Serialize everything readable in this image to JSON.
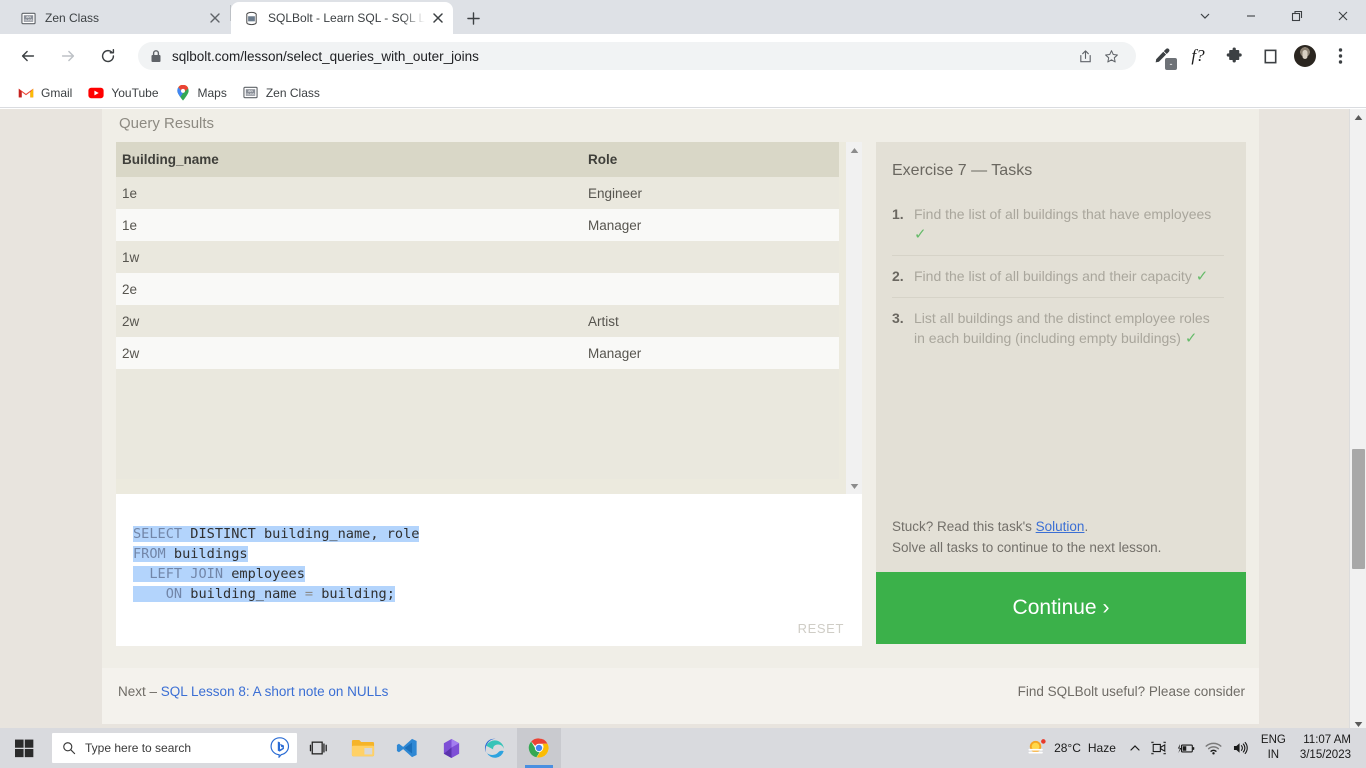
{
  "browser": {
    "tabs": [
      {
        "title": "Zen Class",
        "favicon": "zenclass-icon",
        "active": false
      },
      {
        "title": "SQLBolt - Learn SQL - SQL Lesson",
        "favicon": "database-icon",
        "active": true
      }
    ],
    "newtab_label": "+",
    "window_controls": {
      "minimize": "–",
      "maximize": "❐",
      "close": "✕",
      "expand": "⌄"
    },
    "toolbar": {
      "back": "←",
      "forward": "→",
      "reload": "⟳",
      "url": "sqlbolt.com/lesson/select_queries_with_outer_joins",
      "lock": "lock-icon",
      "share": "share-icon",
      "bookmark_star": "☆",
      "extension_eyedropper": "eyedropper-icon",
      "extension_f": "f?",
      "extension_puzzle": "puzzle-icon",
      "extension_square": "□",
      "menu": "⋮"
    },
    "bookmarks": [
      {
        "label": "Gmail",
        "icon": "gmail-icon"
      },
      {
        "label": "YouTube",
        "icon": "youtube-icon"
      },
      {
        "label": "Maps",
        "icon": "maps-pin-icon"
      },
      {
        "label": "Zen Class",
        "icon": "zenclass-icon"
      }
    ]
  },
  "page": {
    "results_title": "Query Results",
    "table": {
      "columns": [
        "Building_name",
        "Role"
      ],
      "rows": [
        [
          "1e",
          "Engineer"
        ],
        [
          "1e",
          "Manager"
        ],
        [
          "1w",
          ""
        ],
        [
          "2e",
          ""
        ],
        [
          "2w",
          "Artist"
        ],
        [
          "2w",
          "Manager"
        ]
      ]
    },
    "editor": {
      "lines": [
        [
          {
            "t": "SELECT",
            "c": "kw"
          },
          {
            "t": " DISTINCT building_name, role",
            "c": ""
          }
        ],
        [
          {
            "t": "FROM",
            "c": "kw"
          },
          {
            "t": " buildings",
            "c": ""
          }
        ],
        [
          {
            "t": "  LEFT JOIN",
            "c": "kw"
          },
          {
            "t": " employees",
            "c": ""
          }
        ],
        [
          {
            "t": "    ON",
            "c": "kw"
          },
          {
            "t": " building_name ",
            "c": ""
          },
          {
            "t": "=",
            "c": "op"
          },
          {
            "t": " building;",
            "c": ""
          }
        ]
      ],
      "reset_label": "RESET"
    },
    "tasks_panel": {
      "title": "Exercise 7 — Tasks",
      "items": [
        {
          "text": "Find the list of all buildings that have employees",
          "done": true
        },
        {
          "text": "Find the list of all buildings and their capacity",
          "done": true
        },
        {
          "text": "List all buildings and the distinct employee roles in each building (including empty buildings)",
          "done": true
        }
      ],
      "check_mark": "✓",
      "stuck_prefix": "Stuck? Read this task's ",
      "solution_link": "Solution",
      "stuck_suffix": ".",
      "solve_note": "Solve all tasks to continue to the next lesson.",
      "continue_label": "Continue ›"
    },
    "footer": {
      "next_prefix": "Next – ",
      "next_link": "SQL Lesson 8: A short note on NULLs",
      "support_text": "Find SQLBolt useful? Please consider"
    }
  },
  "taskbar": {
    "start_icon": "windows-start-icon",
    "search_placeholder": "Type here to search",
    "search_icon": "search-icon",
    "bing_icon": "bing-chat-icon",
    "apps": [
      {
        "name": "task-view-icon"
      },
      {
        "name": "file-explorer-icon"
      },
      {
        "name": "vscode-icon"
      },
      {
        "name": "office-icon"
      },
      {
        "name": "edge-icon"
      },
      {
        "name": "chrome-icon"
      }
    ],
    "weather": {
      "temperature": "28°C",
      "condition": "Haze"
    },
    "tray": {
      "chevron": "∧",
      "meet": "camera-icon",
      "battery": "battery-icon",
      "wifi": "wifi-icon",
      "volume": "volume-icon"
    },
    "language": {
      "line1": "ENG",
      "line2": "IN"
    },
    "clock": {
      "time": "11:07 AM",
      "date": "3/15/2023"
    }
  },
  "colors": {
    "accent_green": "#3bb14a",
    "link_blue": "#3b6fd4",
    "selection_blue": "#b3d4fc",
    "panel_beige": "#e3e0d6",
    "page_beige": "#f0eee7"
  }
}
